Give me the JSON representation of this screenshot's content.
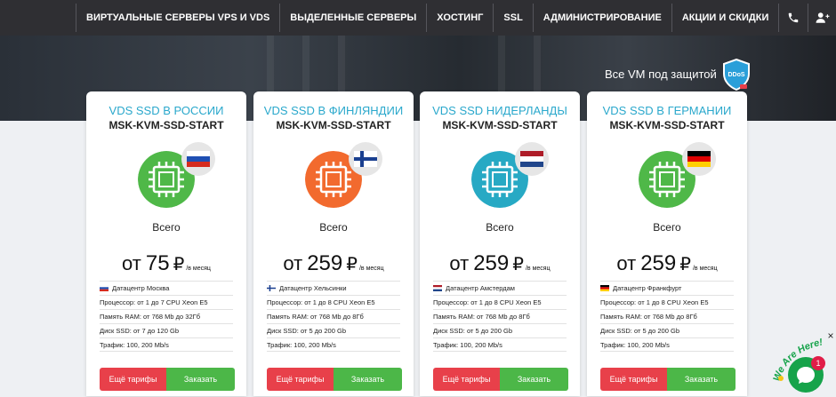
{
  "nav": {
    "items": [
      {
        "label": "ВИРТУАЛЬНЫЕ СЕРВЕРЫ VPS И VDS"
      },
      {
        "label": "ВЫДЕЛЕННЫЕ СЕРВЕРЫ"
      },
      {
        "label": "ХОСТИНГ"
      },
      {
        "label": "SSL"
      },
      {
        "label": "АДМИНИСТРИРОВАНИЕ"
      },
      {
        "label": "АКЦИИ И СКИДКИ"
      }
    ],
    "icons": [
      "phone-icon",
      "add-user-icon",
      "login-icon"
    ]
  },
  "hero": {
    "text": "Все VM под защитой",
    "badge": "DDoS"
  },
  "cards": [
    {
      "title": "VDS SSD В РОССИИ",
      "plan": "MSK-KVM-SSD-START",
      "chip_color": "#4fb848",
      "flag": "russia",
      "vsego": "Всего",
      "price_from": "от",
      "price": "75",
      "currency": "₽",
      "per": "/в месяц",
      "specs": [
        "Датацентр Москва",
        "Процессор: от 1 до 7 CPU Xeon E5",
        "Память RAM: от 768 Mb до 32Гб",
        "Диск SSD: от 7 до 120 Gb",
        "Трафик: 100, 200 Mb/s"
      ],
      "btn_more": "Ещё тарифы",
      "btn_order": "Заказать"
    },
    {
      "title": "VDS SSD В ФИНЛЯНДИИ",
      "plan": "MSK-KVM-SSD-START",
      "chip_color": "#f26a2e",
      "flag": "finland",
      "vsego": "Всего",
      "price_from": "от",
      "price": "259",
      "currency": "₽",
      "per": "/в месяц",
      "specs": [
        "Датацентр Хельсинки",
        "Процессор: от 1 до 8 CPU Xeon E5",
        "Память RAM: от 768 Mb до 8Гб",
        "Диск SSD: от 5 до 200 Gb",
        "Трафик: 100, 200 Mb/s"
      ],
      "btn_more": "Ещё тарифы",
      "btn_order": "Заказать"
    },
    {
      "title": "VDS SSD НИДЕРЛАНДЫ",
      "plan": "MSK-KVM-SSD-START",
      "chip_color": "#27a9c4",
      "flag": "netherlands",
      "vsego": "Всего",
      "price_from": "от",
      "price": "259",
      "currency": "₽",
      "per": "/в месяц",
      "specs": [
        "Датацентр Амстердам",
        "Процессор: от 1 до 8 CPU Xeon E5",
        "Память RAM: от 768 Mb до 8Гб",
        "Диск SSD: от 5 до 200 Gb",
        "Трафик: 100, 200 Mb/s"
      ],
      "btn_more": "Ещё тарифы",
      "btn_order": "Заказать"
    },
    {
      "title": "VDS SSD В ГЕРМАНИИ",
      "plan": "MSK-KVM-SSD-START",
      "chip_color": "#4fb848",
      "flag": "germany",
      "vsego": "Всего",
      "price_from": "от",
      "price": "259",
      "currency": "₽",
      "per": "/в месяц",
      "specs": [
        "Датацентр Франкфурт",
        "Процессор: от 1 до 8 CPU Xeon E5",
        "Память RAM: от 768 Mb до 8Гб",
        "Диск SSD: от 5 до 200 Gb",
        "Трафик: 100, 200 Mb/s"
      ],
      "btn_more": "Ещё тарифы",
      "btn_order": "Заказать"
    }
  ],
  "chat": {
    "label": "We Are Here!",
    "count": "1",
    "close": "×"
  }
}
